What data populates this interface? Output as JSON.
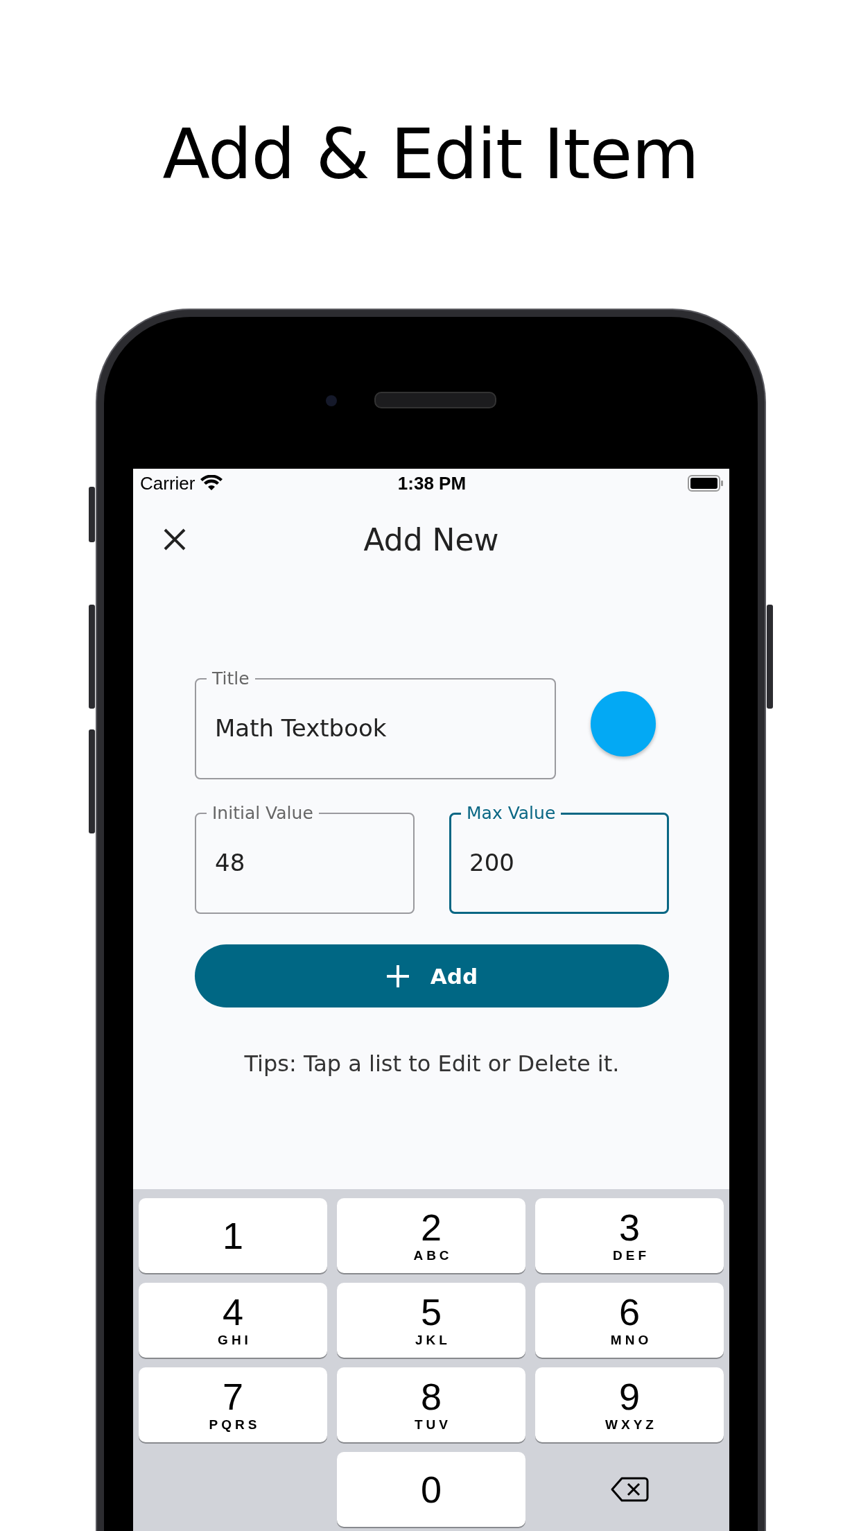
{
  "heading": "Add & Edit Item",
  "status_bar": {
    "carrier": "Carrier",
    "time": "1:38 PM"
  },
  "nav": {
    "title": "Add New"
  },
  "fields": [
    {
      "label": "Title",
      "value": "Math Textbook",
      "focused": false
    },
    {
      "label": "Initial Value",
      "value": "48",
      "focused": false
    },
    {
      "label": "Max Value",
      "value": "200",
      "focused": true
    }
  ],
  "color_swatch": {
    "color": "#03a9f4"
  },
  "add_button": {
    "label": "Add"
  },
  "tip": "Tips: Tap a list to Edit or Delete it.",
  "keypad": [
    {
      "kind": "digit",
      "digit": "1"
    },
    {
      "kind": "digit",
      "digit": "2",
      "letters": "ABC"
    },
    {
      "kind": "digit",
      "digit": "3",
      "letters": "DEF"
    },
    {
      "kind": "digit",
      "digit": "4",
      "letters": "GHI"
    },
    {
      "kind": "digit",
      "digit": "5",
      "letters": "JKL"
    },
    {
      "kind": "digit",
      "digit": "6",
      "letters": "MNO"
    },
    {
      "kind": "digit",
      "digit": "7",
      "letters": "PQRS"
    },
    {
      "kind": "digit",
      "digit": "8",
      "letters": "TUV"
    },
    {
      "kind": "digit",
      "digit": "9",
      "letters": "WXYZ"
    },
    {
      "kind": "digit",
      "digit": "0"
    },
    {
      "kind": "delete"
    }
  ]
}
